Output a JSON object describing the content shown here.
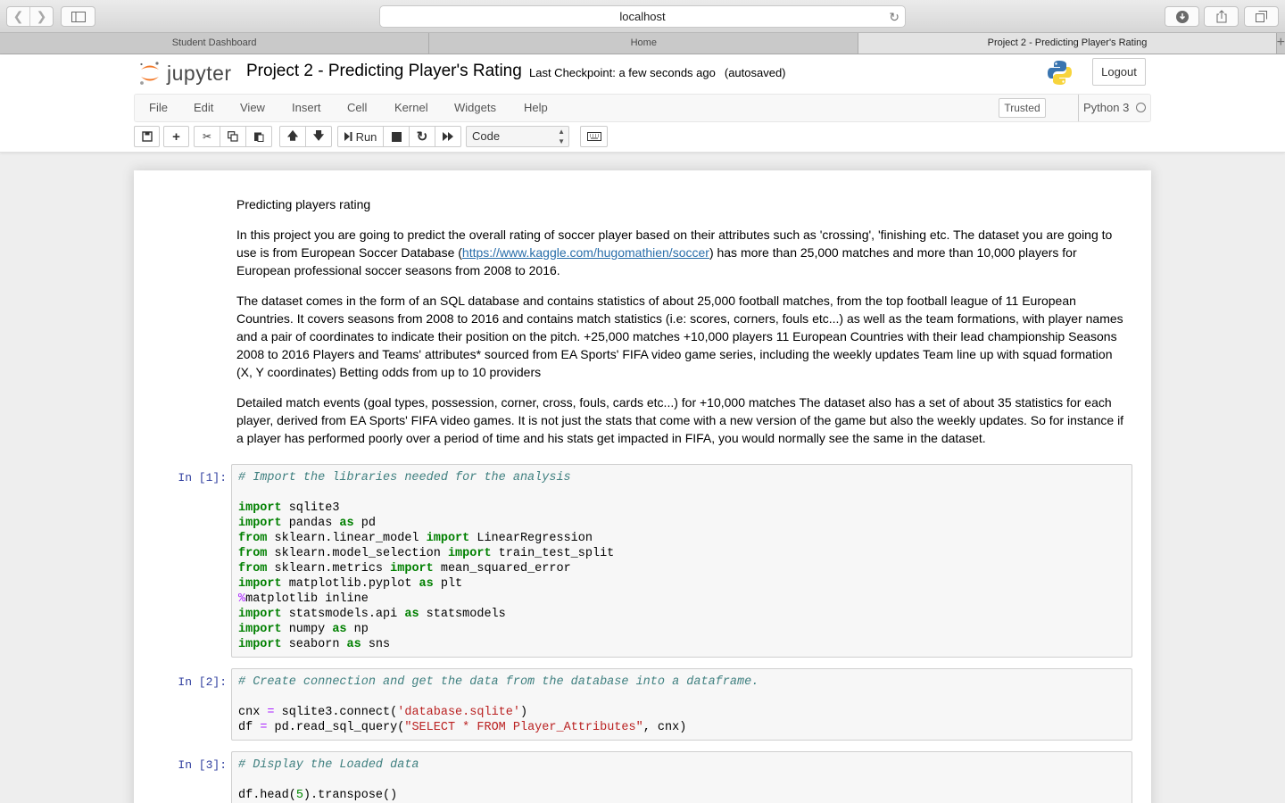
{
  "browser": {
    "url": "localhost",
    "tabs": [
      "Student Dashboard",
      "Home",
      "Project 2 - Predicting Player's Rating"
    ],
    "new_tab": "+"
  },
  "header": {
    "logo_text": "jupyter",
    "notebook_title": "Project 2 - Predicting Player's Rating",
    "checkpoint": "Last Checkpoint: a few seconds ago",
    "autosave": "(autosaved)",
    "logout": "Logout"
  },
  "menubar": {
    "items": [
      "File",
      "Edit",
      "View",
      "Insert",
      "Cell",
      "Kernel",
      "Widgets",
      "Help"
    ],
    "trusted": "Trusted",
    "kernel_name": "Python 3"
  },
  "toolbar": {
    "run_label": "Run",
    "cell_type": "Code"
  },
  "markdown": {
    "heading": "Predicting players rating",
    "p1_before_link": "In this project you are going to predict the overall rating of soccer player based on their attributes such as 'crossing', 'finishing etc. The dataset you are going to use is from European Soccer Database (",
    "p1_link": "https://www.kaggle.com/hugomathien/soccer",
    "p1_after_link": ") has more than 25,000 matches and more than 10,000 players for European professional soccer seasons from 2008 to 2016.",
    "p2": "The dataset comes in the form of an SQL database and contains statistics of about 25,000 football matches, from the top football league of 11 European Countries. It covers seasons from 2008 to 2016 and contains match statistics (i.e: scores, corners, fouls etc...) as well as the team formations, with player names and a pair of coordinates to indicate their position on the pitch. +25,000 matches +10,000 players 11 European Countries with their lead championship Seasons 2008 to 2016 Players and Teams' attributes* sourced from EA Sports' FIFA video game series, including the weekly updates Team line up with squad formation (X, Y coordinates) Betting odds from up to 10 providers",
    "p3": "Detailed match events (goal types, possession, corner, cross, fouls, cards etc...) for +10,000 matches The dataset also has a set of about 35 statistics for each player, derived from EA Sports' FIFA video games. It is not just the stats that come with a new version of the game but also the weekly updates. So for instance if a player has performed poorly over a period of time and his stats get impacted in FIFA, you would normally see the same in the dataset."
  },
  "cells": [
    {
      "prompt": "In [1]:",
      "lines": [
        [
          [
            "cm",
            "# Import the libraries needed for the analysis"
          ]
        ],
        [],
        [
          [
            "kw",
            "import"
          ],
          [
            "",
            " sqlite3"
          ]
        ],
        [
          [
            "kw",
            "import"
          ],
          [
            "",
            " pandas "
          ],
          [
            "kw",
            "as"
          ],
          [
            "",
            " pd"
          ]
        ],
        [
          [
            "kw",
            "from"
          ],
          [
            "",
            " sklearn.linear_model "
          ],
          [
            "kw",
            "import"
          ],
          [
            "",
            " LinearRegression"
          ]
        ],
        [
          [
            "kw",
            "from"
          ],
          [
            "",
            " sklearn.model_selection "
          ],
          [
            "kw",
            "import"
          ],
          [
            "",
            " train_test_split"
          ]
        ],
        [
          [
            "kw",
            "from"
          ],
          [
            "",
            " sklearn.metrics "
          ],
          [
            "kw",
            "import"
          ],
          [
            "",
            " mean_squared_error"
          ]
        ],
        [
          [
            "kw",
            "import"
          ],
          [
            "",
            " matplotlib.pyplot "
          ],
          [
            "kw",
            "as"
          ],
          [
            "",
            " plt"
          ]
        ],
        [
          [
            "mg",
            "%"
          ],
          [
            "",
            "matplotlib inline"
          ]
        ],
        [
          [
            "kw",
            "import"
          ],
          [
            "",
            " statsmodels.api "
          ],
          [
            "kw",
            "as"
          ],
          [
            "",
            " statsmodels"
          ]
        ],
        [
          [
            "kw",
            "import"
          ],
          [
            "",
            " numpy "
          ],
          [
            "kw",
            "as"
          ],
          [
            "",
            " np"
          ]
        ],
        [
          [
            "kw",
            "import"
          ],
          [
            "",
            " seaborn "
          ],
          [
            "kw",
            "as"
          ],
          [
            "",
            " sns"
          ]
        ]
      ]
    },
    {
      "prompt": "In [2]:",
      "lines": [
        [
          [
            "cm",
            "# Create connection and get the data from the database into a dataframe."
          ]
        ],
        [],
        [
          [
            "",
            "cnx "
          ],
          [
            "mg",
            "="
          ],
          [
            "",
            " sqlite3.connect("
          ],
          [
            "st",
            "'database.sqlite'"
          ],
          [
            "",
            ")"
          ]
        ],
        [
          [
            "",
            "df "
          ],
          [
            "mg",
            "="
          ],
          [
            "",
            " pd.read_sql_query("
          ],
          [
            "st",
            "\"SELECT * FROM Player_Attributes\""
          ],
          [
            "",
            ", cnx)"
          ]
        ]
      ]
    },
    {
      "prompt": "In [3]:",
      "lines": [
        [
          [
            "cm",
            "# Display the Loaded data"
          ]
        ],
        [],
        [
          [
            "",
            "df.head("
          ],
          [
            "nm",
            "5"
          ],
          [
            "",
            ").transpose()"
          ]
        ]
      ]
    }
  ],
  "colors": {
    "jupyter_orange": "#f37726",
    "prompt_blue": "#303f9f",
    "link_blue": "#296eaa"
  }
}
